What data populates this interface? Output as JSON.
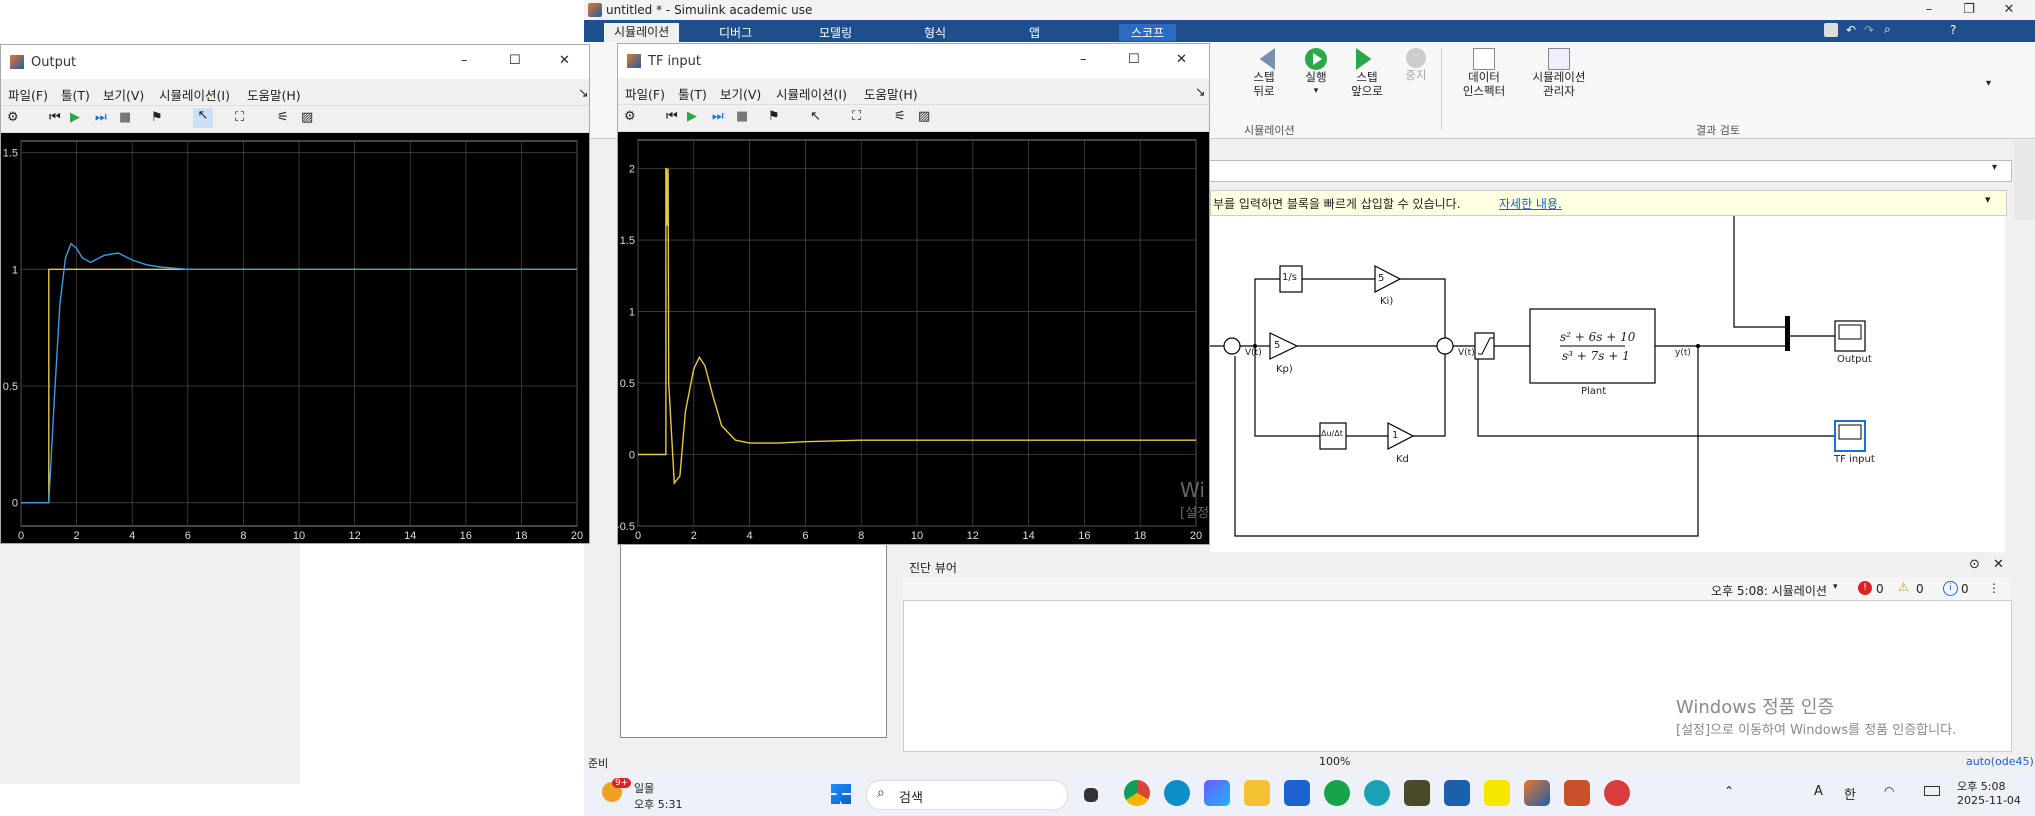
{
  "simulink": {
    "title": "untitled * - Simulink academic use",
    "tabs": [
      "시뮬레이션",
      "디버그",
      "모델링",
      "형식",
      "앱",
      "스코프"
    ],
    "ribbon": {
      "step_back": "스텝\n뒤로",
      "run": "실행",
      "step_forward": "스텝\n앞으로",
      "stop": "중지",
      "section_sim": "시뮬레이션",
      "data_inspector": "데이터\n인스펙터",
      "sim_manager": "시뮬레이션\n관리자",
      "section_review": "결과 검토"
    },
    "notice_text": "부를 입력하면 블록을 빠르게 삽입할 수 있습니다.",
    "notice_link": "자세한 내용.",
    "blocks": {
      "integrator": "1/s",
      "ki_value": "5",
      "ki_label": "Ki)",
      "kp_value": "5",
      "kp_label": "Kp)",
      "kd_value": "1",
      "kd_label": "Kd",
      "deriv": "Δu/Δt",
      "vt1": "V(t)",
      "vt2": "V(t)",
      "yt": "y(t)",
      "plant_num": "s² + 6s + 10",
      "plant_den": "s³ + 7s + 1",
      "plant_label": "Plant",
      "scope_output": "Output",
      "scope_tf": "TF input"
    },
    "diagnostic": {
      "title": "진단 뷰어",
      "time": "오후 5:08: 시뮬레이션",
      "errors": "0",
      "warnings": "0",
      "infos": "0"
    },
    "watermark": {
      "line1": "Windows 정품 인증",
      "line2": "[설정]으로 이동하여 Windows를 정품 인증합니다."
    },
    "status": {
      "left": "준비",
      "zoom": "100%",
      "solver": "auto(ode45)"
    }
  },
  "taskbar": {
    "weather": "일몰",
    "weather_time": "오후 5:31",
    "badge": "9+",
    "search": "검색",
    "ime": "한",
    "lang": "A",
    "clock_time": "오후 5:08",
    "clock_date": "2025-11-04"
  },
  "scope_output": {
    "title": "Output",
    "menu": [
      "파일(F)",
      "툴(T)",
      "보기(V)",
      "시뮬레이션(I)",
      "도움말(H)"
    ]
  },
  "scope_tf": {
    "title": "TF input",
    "menu": [
      "파일(F)",
      "툴(T)",
      "보기(V)",
      "시뮬레이션(I)",
      "도움말(H)"
    ],
    "watermark": "Wi",
    "watermark2": "[설정"
  },
  "chart_data": [
    {
      "type": "line",
      "title": "",
      "xlabel": "",
      "ylabel": "",
      "xlim": [
        0,
        20
      ],
      "ylim": [
        -0.1,
        1.55
      ],
      "x_ticks": [
        0,
        2,
        4,
        6,
        8,
        10,
        12,
        14,
        16,
        18,
        20
      ],
      "y_ticks": [
        0,
        0.5,
        1,
        1.5
      ],
      "y_tick_labels": [
        "0",
        "0.5",
        "1",
        "1.5"
      ],
      "grid": true,
      "series": [
        {
          "color": "#e6c84a",
          "x": [
            0,
            1,
            1,
            20
          ],
          "y": [
            0,
            0,
            1,
            1
          ]
        },
        {
          "color": "#3d9be0",
          "x": [
            0,
            1,
            1.2,
            1.4,
            1.6,
            1.8,
            2.0,
            2.2,
            2.5,
            3.0,
            3.5,
            4.0,
            4.5,
            5.0,
            6.0,
            8.0,
            20.0
          ],
          "y": [
            0,
            0,
            0.45,
            0.85,
            1.05,
            1.11,
            1.09,
            1.05,
            1.03,
            1.06,
            1.07,
            1.04,
            1.02,
            1.01,
            1.0,
            1.0,
            1.0
          ]
        }
      ]
    },
    {
      "type": "line",
      "title": "",
      "xlabel": "",
      "ylabel": "",
      "xlim": [
        0,
        20
      ],
      "ylim": [
        -0.5,
        2.2
      ],
      "x_ticks": [
        0,
        2,
        4,
        6,
        8,
        10,
        12,
        14,
        16,
        18,
        20
      ],
      "y_ticks": [
        -0.5,
        0,
        0.5,
        1,
        1.5,
        2
      ],
      "y_tick_labels": [
        "-0.5",
        "0",
        "0.5",
        "1",
        "1.5",
        "2"
      ],
      "grid": true,
      "series": [
        {
          "color": "#e6c84a",
          "x": [
            0,
            1.0,
            1.0,
            1.02,
            1.05,
            1.08,
            1.1,
            1.3,
            1.5,
            1.7,
            2.0,
            2.2,
            2.4,
            2.7,
            3.0,
            3.5,
            4.0,
            5.0,
            6.0,
            8.0,
            20.0
          ],
          "y": [
            0,
            0,
            2.0,
            2.0,
            1.6,
            2.0,
            0.5,
            -0.2,
            -0.15,
            0.3,
            0.6,
            0.68,
            0.62,
            0.4,
            0.2,
            0.1,
            0.08,
            0.08,
            0.09,
            0.1,
            0.1
          ]
        }
      ]
    }
  ]
}
